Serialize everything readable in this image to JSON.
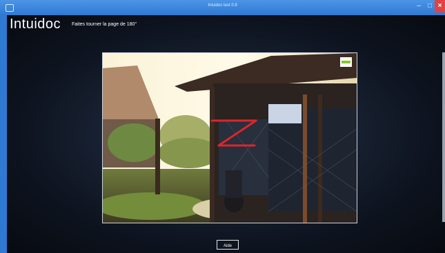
{
  "window": {
    "title": "Intuidoc test 0.9",
    "controls": {
      "minimize": "–",
      "maximize": "□",
      "close": "×"
    }
  },
  "app": {
    "title": "Intuidoc",
    "instruction": "Faites tourner la page de 180°"
  },
  "buttons": {
    "help": "Aide"
  },
  "colors": {
    "titlebar": "#2f79d3",
    "background": "#0b0f16",
    "stroke_red": "#e0242a",
    "stroke_green": "#87c92b"
  },
  "icons": [
    "app-window-icon",
    "minimize-icon",
    "maximize-icon",
    "close-icon",
    "rotate-gesture-icon"
  ]
}
